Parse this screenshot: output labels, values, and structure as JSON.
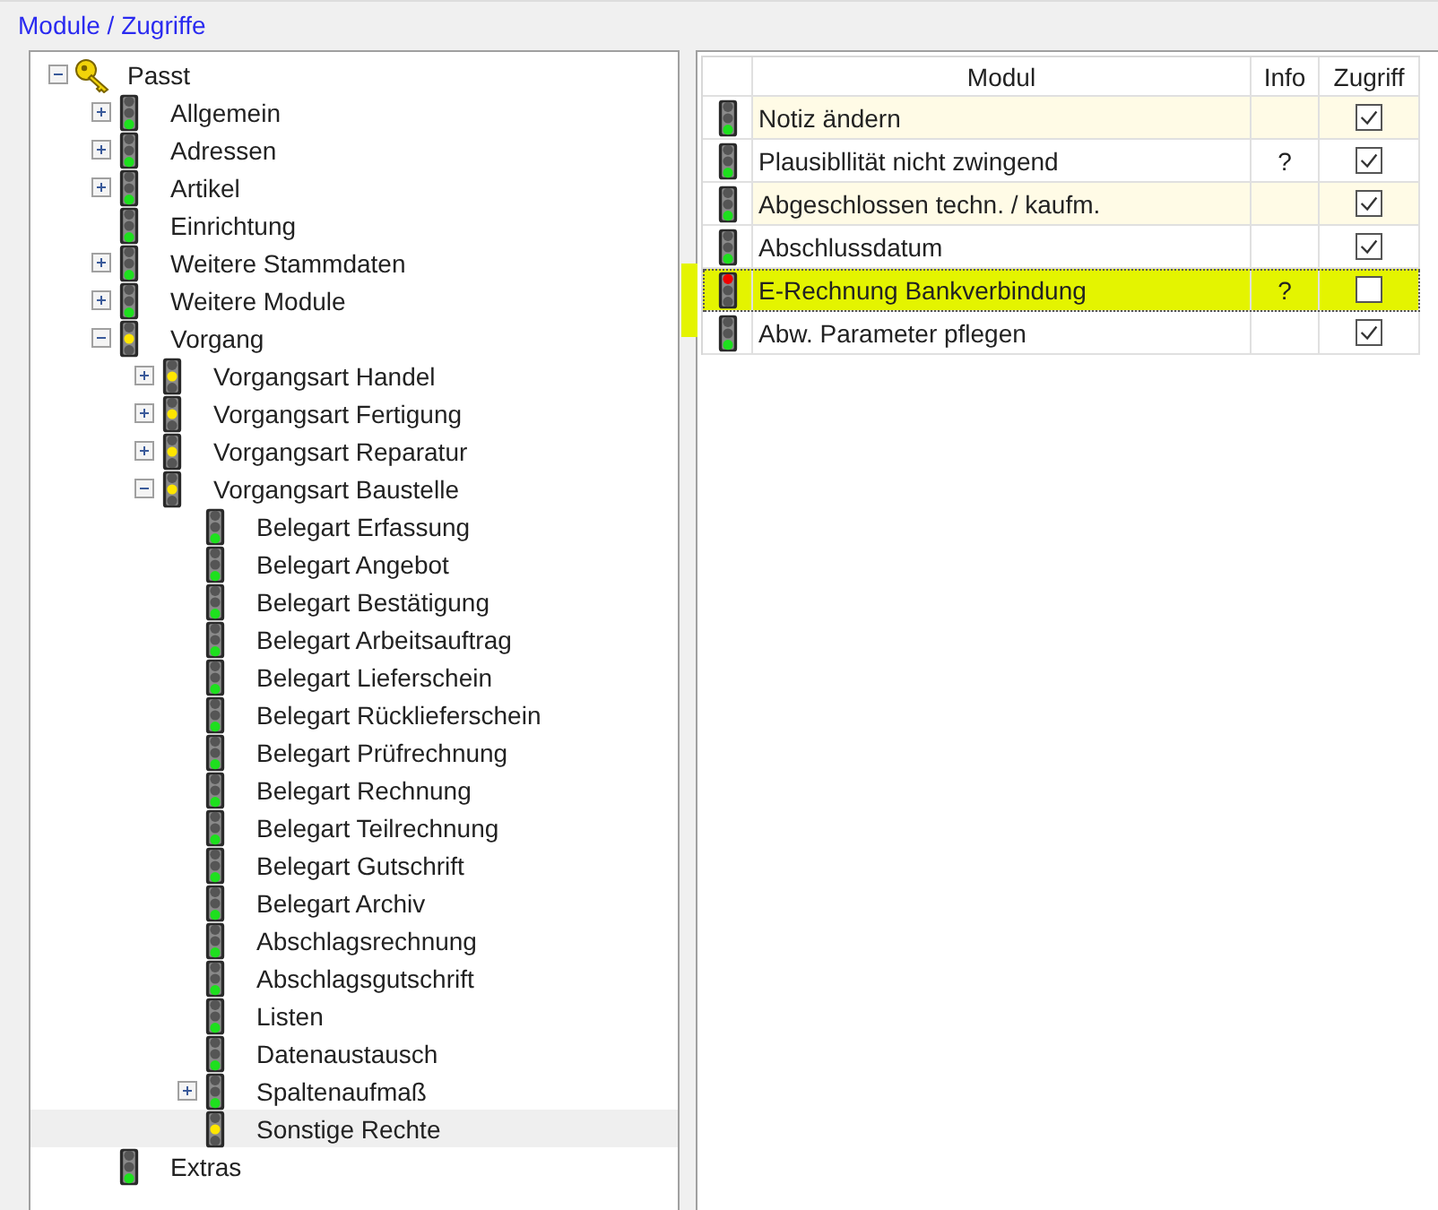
{
  "group_title": "Module / Zugriffe",
  "tree": [
    {
      "label": "Passt",
      "kind": "key",
      "expanded": true,
      "children": [
        {
          "label": "Allgemein",
          "kind": "green",
          "expanded": false
        },
        {
          "label": "Adressen",
          "kind": "green",
          "expanded": false
        },
        {
          "label": "Artikel",
          "kind": "green",
          "expanded": false
        },
        {
          "label": "Einrichtung",
          "kind": "green"
        },
        {
          "label": "Weitere Stammdaten",
          "kind": "green",
          "expanded": false
        },
        {
          "label": "Weitere Module",
          "kind": "green",
          "expanded": false
        },
        {
          "label": "Vorgang",
          "kind": "yellow",
          "expanded": true,
          "children": [
            {
              "label": "Vorgangsart Handel",
              "kind": "yellow",
              "expanded": false
            },
            {
              "label": "Vorgangsart Fertigung",
              "kind": "yellow",
              "expanded": false
            },
            {
              "label": "Vorgangsart Reparatur",
              "kind": "yellow",
              "expanded": false
            },
            {
              "label": "Vorgangsart Baustelle",
              "kind": "yellow",
              "expanded": true,
              "children": [
                {
                  "label": "Belegart Erfassung",
                  "kind": "green"
                },
                {
                  "label": "Belegart Angebot",
                  "kind": "green"
                },
                {
                  "label": "Belegart Bestätigung",
                  "kind": "green"
                },
                {
                  "label": "Belegart Arbeitsauftrag",
                  "kind": "green"
                },
                {
                  "label": "Belegart Lieferschein",
                  "kind": "green"
                },
                {
                  "label": "Belegart Rücklieferschein",
                  "kind": "green"
                },
                {
                  "label": "Belegart Prüfrechnung",
                  "kind": "green"
                },
                {
                  "label": "Belegart Rechnung",
                  "kind": "green"
                },
                {
                  "label": "Belegart Teilrechnung",
                  "kind": "green"
                },
                {
                  "label": "Belegart Gutschrift",
                  "kind": "green"
                },
                {
                  "label": "Belegart Archiv",
                  "kind": "green"
                },
                {
                  "label": "Abschlagsrechnung",
                  "kind": "green"
                },
                {
                  "label": "Abschlagsgutschrift",
                  "kind": "green"
                },
                {
                  "label": "Listen",
                  "kind": "green"
                },
                {
                  "label": "Datenaustausch",
                  "kind": "green"
                },
                {
                  "label": "Spaltenaufmaß",
                  "kind": "green",
                  "expanded": false
                },
                {
                  "label": "Sonstige Rechte",
                  "kind": "yellow",
                  "selected": true
                }
              ]
            }
          ]
        },
        {
          "label": "Extras",
          "kind": "green"
        }
      ]
    }
  ],
  "table": {
    "columns": [
      "Modul",
      "Info",
      "Zugriff"
    ],
    "rows": [
      {
        "kind": "green",
        "modul": "Notiz ändern",
        "checked": true,
        "tinted": true,
        "selected": false
      },
      {
        "kind": "green",
        "modul": "Plausibllität nicht zwingend",
        "info": "?",
        "checked": true,
        "tinted": false,
        "selected": false
      },
      {
        "kind": "green",
        "modul": "Abgeschlossen techn. / kaufm.",
        "checked": true,
        "tinted": true,
        "selected": false
      },
      {
        "kind": "green",
        "modul": "Abschlussdatum",
        "checked": true,
        "tinted": false,
        "selected": false
      },
      {
        "kind": "red",
        "modul": "E-Rechnung Bankverbindung",
        "info": "?",
        "checked": false,
        "tinted": false,
        "selected": true
      },
      {
        "kind": "green",
        "modul": "Abw. Parameter pflegen",
        "checked": true,
        "tinted": false,
        "selected": false
      }
    ]
  }
}
